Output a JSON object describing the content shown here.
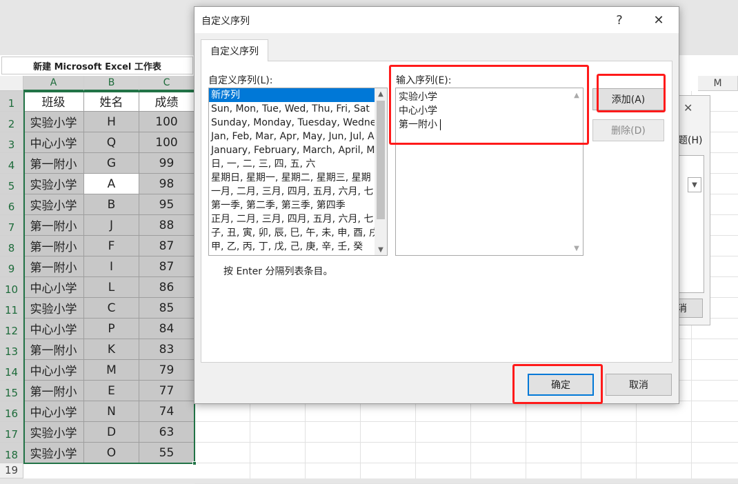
{
  "workbook_tab": "新建 Microsoft Excel 工作表",
  "columns": {
    "A": "A",
    "B": "B",
    "C": "C",
    "M": "M"
  },
  "rows": [
    "1",
    "2",
    "3",
    "4",
    "5",
    "6",
    "7",
    "8",
    "9",
    "10",
    "11",
    "12",
    "13",
    "14",
    "15",
    "16",
    "17",
    "18",
    "19"
  ],
  "table": {
    "headers": [
      "班级",
      "姓名",
      "成绩"
    ],
    "data": [
      [
        "实验小学",
        "H",
        "100"
      ],
      [
        "中心小学",
        "Q",
        "100"
      ],
      [
        "第一附小",
        "G",
        "99"
      ],
      [
        "实验小学",
        "A",
        "98"
      ],
      [
        "实验小学",
        "B",
        "95"
      ],
      [
        "第一附小",
        "J",
        "88"
      ],
      [
        "第一附小",
        "F",
        "87"
      ],
      [
        "第一附小",
        "I",
        "87"
      ],
      [
        "中心小学",
        "L",
        "86"
      ],
      [
        "实验小学",
        "C",
        "85"
      ],
      [
        "中心小学",
        "P",
        "84"
      ],
      [
        "第一附小",
        "K",
        "83"
      ],
      [
        "中心小学",
        "M",
        "79"
      ],
      [
        "第一附小",
        "E",
        "77"
      ],
      [
        "中心小学",
        "N",
        "74"
      ],
      [
        "实验小学",
        "D",
        "63"
      ],
      [
        "实验小学",
        "O",
        "55"
      ]
    ]
  },
  "bg_dialog": {
    "close": "✕",
    "fragment_label": "题(H)",
    "fragment_button": "消"
  },
  "dialog": {
    "title": "自定义序列",
    "help": "?",
    "close": "✕",
    "tab": "自定义序列",
    "list_label": "自定义序列(L):",
    "list_items": [
      "新序列",
      "Sun, Mon, Tue, Wed, Thu, Fri, Sat",
      "Sunday, Monday, Tuesday, Wednesday",
      "Jan, Feb, Mar, Apr, May, Jun, Jul, A",
      "January, February, March, April, M",
      "日, 一, 二, 三, 四, 五, 六",
      "星期日, 星期一, 星期二, 星期三, 星期",
      "一月, 二月, 三月, 四月, 五月, 六月, 七",
      "第一季, 第二季, 第三季, 第四季",
      "正月, 二月, 三月, 四月, 五月, 六月, 七",
      "子, 丑, 寅, 卯, 辰, 巳, 午, 未, 申, 酉, 戌",
      "甲, 乙, 丙, 丁, 戊, 己, 庚, 辛, 壬, 癸"
    ],
    "input_label": "输入序列(E):",
    "input_lines": [
      "实验小学",
      "中心小学",
      "第一附小"
    ],
    "add_button": "添加(A)",
    "delete_button": "删除(D)",
    "hint": "按 Enter 分隔列表条目。",
    "ok_button": "确定",
    "cancel_button": "取消"
  },
  "colors": {
    "selection_green": "#217346",
    "list_selected": "#0078d7",
    "highlight_red": "#ff1a1a"
  }
}
